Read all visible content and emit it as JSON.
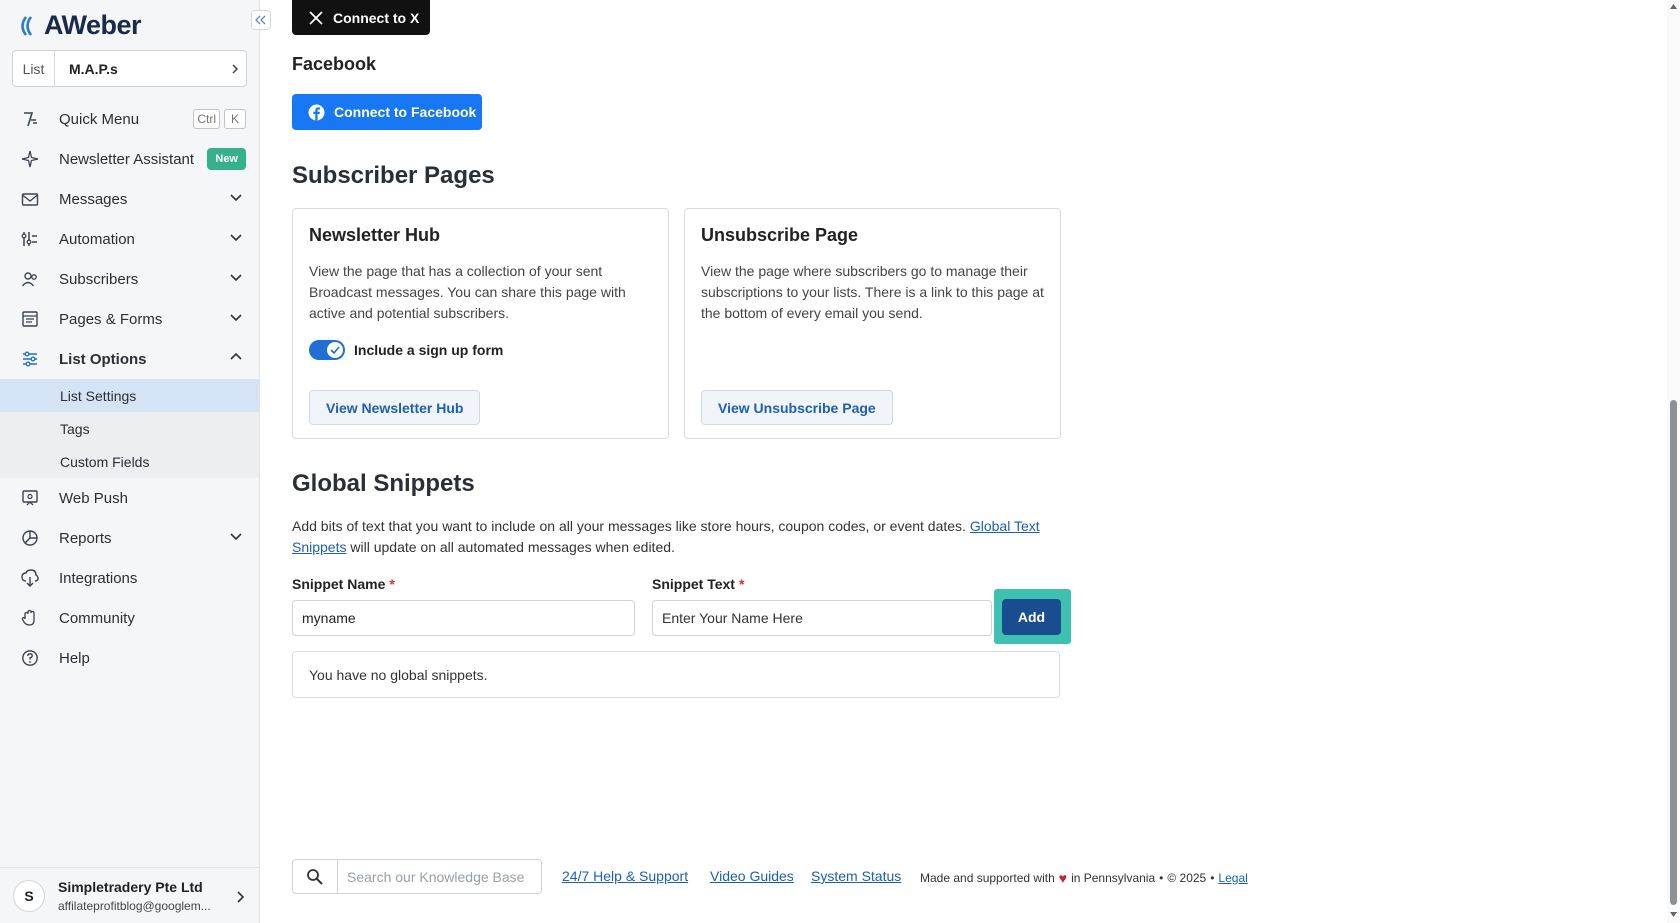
{
  "brand": {
    "logo_text": "AWeber"
  },
  "list_picker": {
    "label": "List",
    "value": "M.A.P.s"
  },
  "sidebar": {
    "quick_menu": {
      "label": "Quick Menu",
      "kbd1": "Ctrl",
      "kbd2": "K"
    },
    "newsletter_assistant": {
      "label": "Newsletter Assistant",
      "badge": "New"
    },
    "messages": "Messages",
    "automation": "Automation",
    "subscribers": "Subscribers",
    "pages_forms": "Pages & Forms",
    "list_options": "List Options",
    "list_options_items": [
      "List Settings",
      "Tags",
      "Custom Fields"
    ],
    "web_push": "Web Push",
    "reports": "Reports",
    "integrations": "Integrations",
    "community": "Community",
    "help": "Help"
  },
  "account": {
    "avatar_initial": "S",
    "name": "Simpletradery Pte Ltd",
    "email": "affilateprofitblog@googlem..."
  },
  "social": {
    "x_button": "Connect to X",
    "facebook_heading": "Facebook",
    "facebook_button": "Connect to Facebook"
  },
  "subscriber_pages": {
    "title": "Subscriber Pages",
    "newsletter_hub": {
      "title": "Newsletter Hub",
      "description": "View the page that has a collection of your sent Broadcast messages. You can share this page with active and potential subscribers.",
      "toggle_label": "Include a sign up form",
      "toggle_on": true,
      "button": "View Newsletter Hub"
    },
    "unsubscribe": {
      "title": "Unsubscribe Page",
      "description": "View the page where subscribers go to manage their subscriptions to your lists. There is a link to this page at the bottom of every email you send.",
      "button": "View Unsubscribe Page"
    }
  },
  "global_snippets": {
    "title": "Global Snippets",
    "description_pre": "Add bits of text that you want to include on all your messages like store hours, coupon codes, or event dates.",
    "description_link": "Global Text Snippets",
    "description_post": "will update on all automated messages when edited.",
    "name_label": "Snippet Name",
    "name_value": "myname",
    "text_label": "Snippet Text",
    "text_value": "Enter Your Name Here",
    "required_mark": "*",
    "add_button": "Add",
    "empty_message": "You have no global snippets."
  },
  "footer": {
    "search_placeholder": "Search our Knowledge Base",
    "help_link": "24/7 Help & Support",
    "video_link": "Video Guides",
    "status_link": "System Status",
    "made_pre": "Made and supported with",
    "made_post": "in Pennsylvania",
    "separator": "•",
    "copyright": "© 2025",
    "legal": "Legal"
  },
  "colors": {
    "primary_blue": "#1c5fb8",
    "facebook_blue": "#1877f2",
    "add_button": "#1a4d8f",
    "focus_ring": "#3ec1b0",
    "new_badge": "#35b28c",
    "selected_sub_item": "#d5e3f7"
  }
}
